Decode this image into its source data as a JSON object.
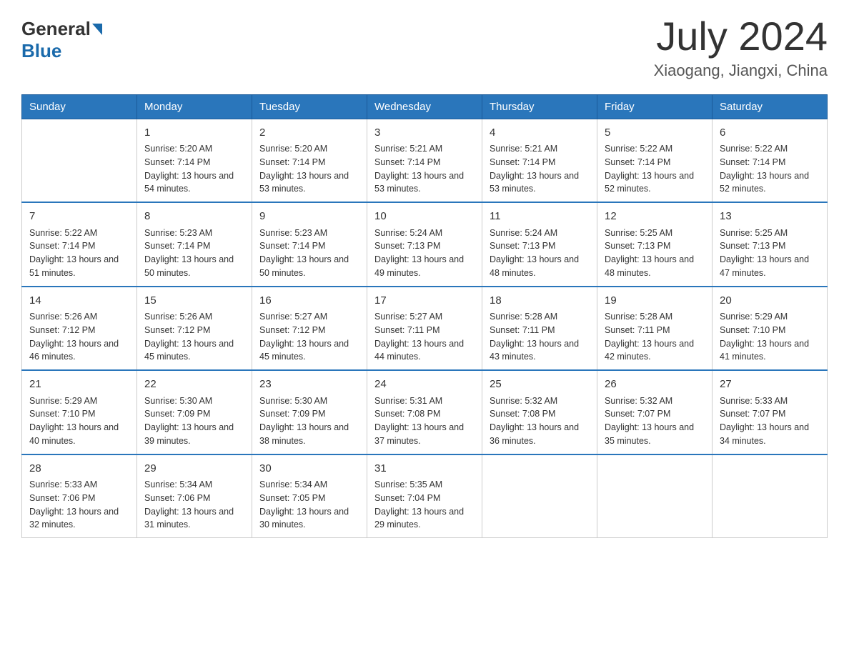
{
  "header": {
    "logo_general": "General",
    "logo_blue": "Blue",
    "title": "July 2024",
    "location": "Xiaogang, Jiangxi, China"
  },
  "days_of_week": [
    "Sunday",
    "Monday",
    "Tuesday",
    "Wednesday",
    "Thursday",
    "Friday",
    "Saturday"
  ],
  "weeks": [
    [
      {
        "day": "",
        "sunrise": "",
        "sunset": "",
        "daylight": ""
      },
      {
        "day": "1",
        "sunrise": "Sunrise: 5:20 AM",
        "sunset": "Sunset: 7:14 PM",
        "daylight": "Daylight: 13 hours and 54 minutes."
      },
      {
        "day": "2",
        "sunrise": "Sunrise: 5:20 AM",
        "sunset": "Sunset: 7:14 PM",
        "daylight": "Daylight: 13 hours and 53 minutes."
      },
      {
        "day": "3",
        "sunrise": "Sunrise: 5:21 AM",
        "sunset": "Sunset: 7:14 PM",
        "daylight": "Daylight: 13 hours and 53 minutes."
      },
      {
        "day": "4",
        "sunrise": "Sunrise: 5:21 AM",
        "sunset": "Sunset: 7:14 PM",
        "daylight": "Daylight: 13 hours and 53 minutes."
      },
      {
        "day": "5",
        "sunrise": "Sunrise: 5:22 AM",
        "sunset": "Sunset: 7:14 PM",
        "daylight": "Daylight: 13 hours and 52 minutes."
      },
      {
        "day": "6",
        "sunrise": "Sunrise: 5:22 AM",
        "sunset": "Sunset: 7:14 PM",
        "daylight": "Daylight: 13 hours and 52 minutes."
      }
    ],
    [
      {
        "day": "7",
        "sunrise": "Sunrise: 5:22 AM",
        "sunset": "Sunset: 7:14 PM",
        "daylight": "Daylight: 13 hours and 51 minutes."
      },
      {
        "day": "8",
        "sunrise": "Sunrise: 5:23 AM",
        "sunset": "Sunset: 7:14 PM",
        "daylight": "Daylight: 13 hours and 50 minutes."
      },
      {
        "day": "9",
        "sunrise": "Sunrise: 5:23 AM",
        "sunset": "Sunset: 7:14 PM",
        "daylight": "Daylight: 13 hours and 50 minutes."
      },
      {
        "day": "10",
        "sunrise": "Sunrise: 5:24 AM",
        "sunset": "Sunset: 7:13 PM",
        "daylight": "Daylight: 13 hours and 49 minutes."
      },
      {
        "day": "11",
        "sunrise": "Sunrise: 5:24 AM",
        "sunset": "Sunset: 7:13 PM",
        "daylight": "Daylight: 13 hours and 48 minutes."
      },
      {
        "day": "12",
        "sunrise": "Sunrise: 5:25 AM",
        "sunset": "Sunset: 7:13 PM",
        "daylight": "Daylight: 13 hours and 48 minutes."
      },
      {
        "day": "13",
        "sunrise": "Sunrise: 5:25 AM",
        "sunset": "Sunset: 7:13 PM",
        "daylight": "Daylight: 13 hours and 47 minutes."
      }
    ],
    [
      {
        "day": "14",
        "sunrise": "Sunrise: 5:26 AM",
        "sunset": "Sunset: 7:12 PM",
        "daylight": "Daylight: 13 hours and 46 minutes."
      },
      {
        "day": "15",
        "sunrise": "Sunrise: 5:26 AM",
        "sunset": "Sunset: 7:12 PM",
        "daylight": "Daylight: 13 hours and 45 minutes."
      },
      {
        "day": "16",
        "sunrise": "Sunrise: 5:27 AM",
        "sunset": "Sunset: 7:12 PM",
        "daylight": "Daylight: 13 hours and 45 minutes."
      },
      {
        "day": "17",
        "sunrise": "Sunrise: 5:27 AM",
        "sunset": "Sunset: 7:11 PM",
        "daylight": "Daylight: 13 hours and 44 minutes."
      },
      {
        "day": "18",
        "sunrise": "Sunrise: 5:28 AM",
        "sunset": "Sunset: 7:11 PM",
        "daylight": "Daylight: 13 hours and 43 minutes."
      },
      {
        "day": "19",
        "sunrise": "Sunrise: 5:28 AM",
        "sunset": "Sunset: 7:11 PM",
        "daylight": "Daylight: 13 hours and 42 minutes."
      },
      {
        "day": "20",
        "sunrise": "Sunrise: 5:29 AM",
        "sunset": "Sunset: 7:10 PM",
        "daylight": "Daylight: 13 hours and 41 minutes."
      }
    ],
    [
      {
        "day": "21",
        "sunrise": "Sunrise: 5:29 AM",
        "sunset": "Sunset: 7:10 PM",
        "daylight": "Daylight: 13 hours and 40 minutes."
      },
      {
        "day": "22",
        "sunrise": "Sunrise: 5:30 AM",
        "sunset": "Sunset: 7:09 PM",
        "daylight": "Daylight: 13 hours and 39 minutes."
      },
      {
        "day": "23",
        "sunrise": "Sunrise: 5:30 AM",
        "sunset": "Sunset: 7:09 PM",
        "daylight": "Daylight: 13 hours and 38 minutes."
      },
      {
        "day": "24",
        "sunrise": "Sunrise: 5:31 AM",
        "sunset": "Sunset: 7:08 PM",
        "daylight": "Daylight: 13 hours and 37 minutes."
      },
      {
        "day": "25",
        "sunrise": "Sunrise: 5:32 AM",
        "sunset": "Sunset: 7:08 PM",
        "daylight": "Daylight: 13 hours and 36 minutes."
      },
      {
        "day": "26",
        "sunrise": "Sunrise: 5:32 AM",
        "sunset": "Sunset: 7:07 PM",
        "daylight": "Daylight: 13 hours and 35 minutes."
      },
      {
        "day": "27",
        "sunrise": "Sunrise: 5:33 AM",
        "sunset": "Sunset: 7:07 PM",
        "daylight": "Daylight: 13 hours and 34 minutes."
      }
    ],
    [
      {
        "day": "28",
        "sunrise": "Sunrise: 5:33 AM",
        "sunset": "Sunset: 7:06 PM",
        "daylight": "Daylight: 13 hours and 32 minutes."
      },
      {
        "day": "29",
        "sunrise": "Sunrise: 5:34 AM",
        "sunset": "Sunset: 7:06 PM",
        "daylight": "Daylight: 13 hours and 31 minutes."
      },
      {
        "day": "30",
        "sunrise": "Sunrise: 5:34 AM",
        "sunset": "Sunset: 7:05 PM",
        "daylight": "Daylight: 13 hours and 30 minutes."
      },
      {
        "day": "31",
        "sunrise": "Sunrise: 5:35 AM",
        "sunset": "Sunset: 7:04 PM",
        "daylight": "Daylight: 13 hours and 29 minutes."
      },
      {
        "day": "",
        "sunrise": "",
        "sunset": "",
        "daylight": ""
      },
      {
        "day": "",
        "sunrise": "",
        "sunset": "",
        "daylight": ""
      },
      {
        "day": "",
        "sunrise": "",
        "sunset": "",
        "daylight": ""
      }
    ]
  ]
}
